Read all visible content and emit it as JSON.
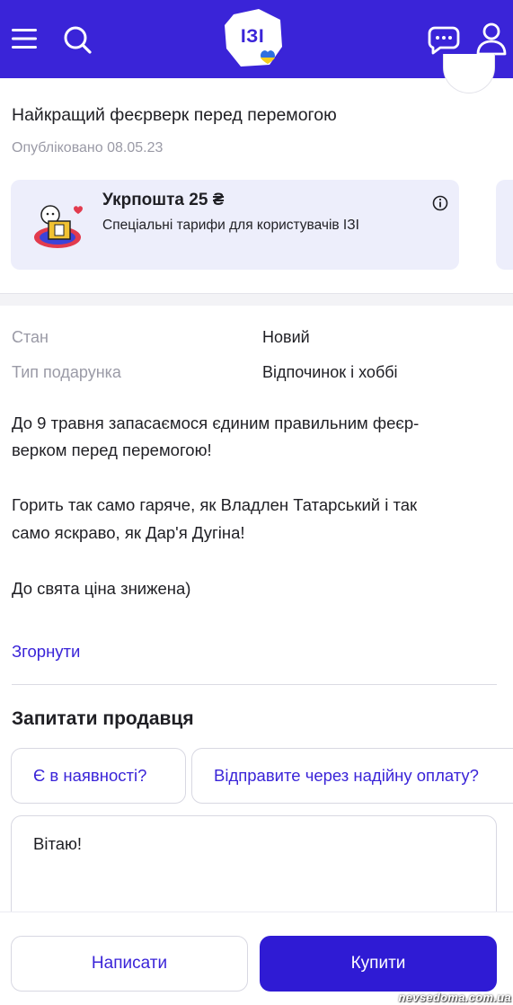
{
  "header": {
    "logo_text": "ІЗІ",
    "icons": [
      "menu-icon",
      "search-icon",
      "chat-icon",
      "user-icon"
    ],
    "background_color": "#3a24d8"
  },
  "listing": {
    "title": "Найкращий феєрверк перед перемогою",
    "published": "Опубліковано 08.05.23"
  },
  "promo": {
    "title": "Укрпошта 25 ₴",
    "subtitle": "Спеціальні тарифи для користувачів ІЗІ"
  },
  "properties": [
    {
      "label": "Стан",
      "value": "Новий"
    },
    {
      "label": "Тип подарунка",
      "value": "Відпочинок і хоббі"
    }
  ],
  "description": {
    "line1": "До 9 травня запасаємося єдиним правильним феєр-",
    "line2": "верком перед перемогою!",
    "line3": "Горить так само гаряче, як Владлен Татарський і так",
    "line4": "само яскраво, як Дар'я Дугіна!",
    "line5": "До свята ціна знижена)"
  },
  "collapse_label": "Згорнути",
  "ask_seller": {
    "title": "Запитати продавця",
    "chips": [
      "Є в наявності?",
      "Відправите через надійну оплату?"
    ],
    "message_value": "Вітаю!"
  },
  "actions": {
    "write_label": "Написати",
    "buy_label": "Купити",
    "accent_color": "#2f1bd4"
  },
  "watermark": "nevsedoma.com.ua"
}
